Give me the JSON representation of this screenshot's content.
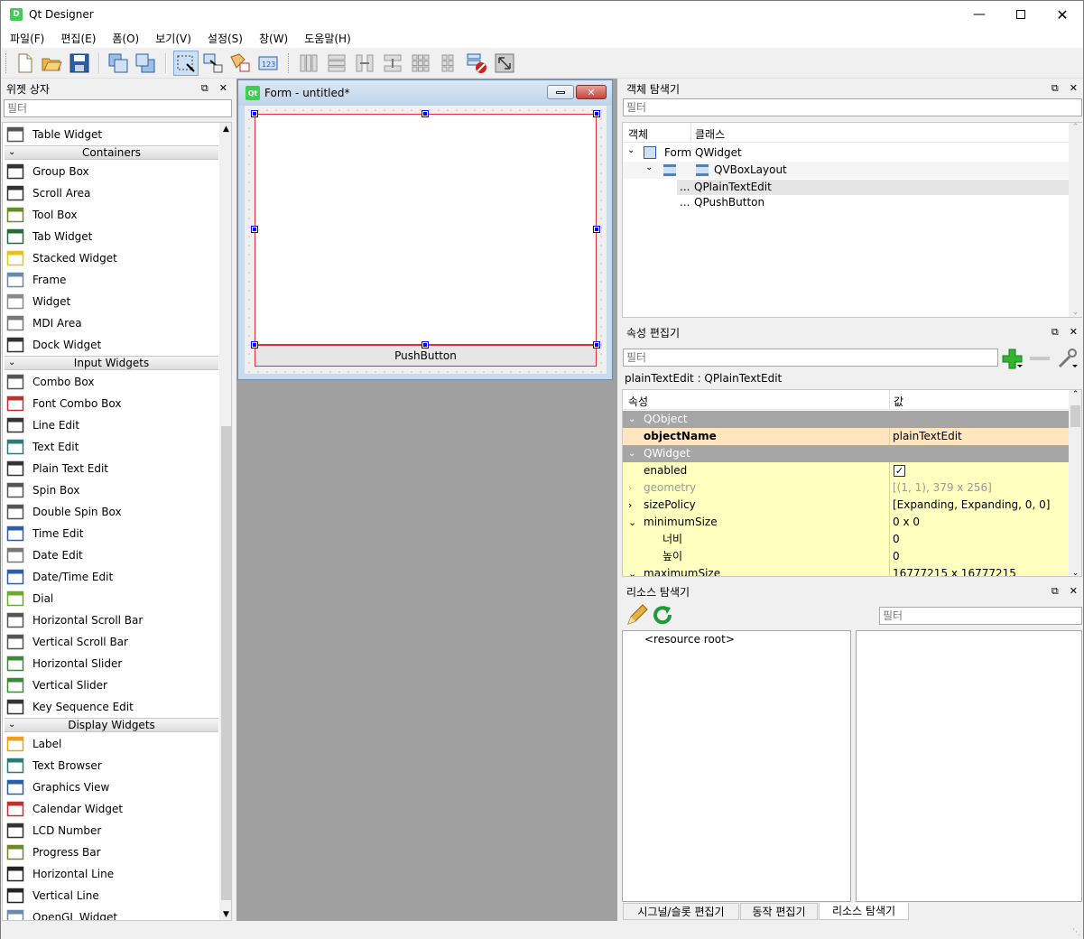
{
  "window": {
    "title": "Qt Designer",
    "app_icon": "D"
  },
  "menu": [
    "파일(F)",
    "편집(E)",
    "폼(O)",
    "보기(V)",
    "설정(S)",
    "창(W)",
    "도움말(H)"
  ],
  "toolbar_icons": [
    "new-file-icon",
    "open-folder-icon",
    "save-icon",
    "bring-to-front-icon",
    "send-to-back-icon",
    "edit-widgets-icon",
    "edit-signals-slots-icon",
    "edit-buddies-icon",
    "edit-tab-order-icon",
    "layout-horizontal-icon",
    "layout-vertical-icon",
    "layout-horizontal-splitter-icon",
    "layout-vertical-splitter-icon",
    "layout-grid-icon",
    "layout-form-icon",
    "break-layout-icon",
    "adjust-size-icon"
  ],
  "widget_box": {
    "title": "위젯 상자",
    "filter_placeholder": "필터",
    "items": [
      {
        "kind": "item",
        "label": "Table Widget",
        "icon": "table-widget-icon"
      },
      {
        "kind": "cat",
        "label": "Containers"
      },
      {
        "kind": "item",
        "label": "Group Box",
        "icon": "group-box-icon"
      },
      {
        "kind": "item",
        "label": "Scroll Area",
        "icon": "scroll-area-icon"
      },
      {
        "kind": "item",
        "label": "Tool Box",
        "icon": "tool-box-icon"
      },
      {
        "kind": "item",
        "label": "Tab Widget",
        "icon": "tab-widget-icon"
      },
      {
        "kind": "item",
        "label": "Stacked Widget",
        "icon": "stacked-widget-icon"
      },
      {
        "kind": "item",
        "label": "Frame",
        "icon": "frame-icon"
      },
      {
        "kind": "item",
        "label": "Widget",
        "icon": "widget-icon"
      },
      {
        "kind": "item",
        "label": "MDI Area",
        "icon": "mdi-area-icon"
      },
      {
        "kind": "item",
        "label": "Dock Widget",
        "icon": "dock-widget-icon"
      },
      {
        "kind": "cat",
        "label": "Input Widgets"
      },
      {
        "kind": "item",
        "label": "Combo Box",
        "icon": "combo-box-icon"
      },
      {
        "kind": "item",
        "label": "Font Combo Box",
        "icon": "font-combo-box-icon"
      },
      {
        "kind": "item",
        "label": "Line Edit",
        "icon": "line-edit-icon"
      },
      {
        "kind": "item",
        "label": "Text Edit",
        "icon": "text-edit-icon"
      },
      {
        "kind": "item",
        "label": "Plain Text Edit",
        "icon": "plain-text-edit-icon"
      },
      {
        "kind": "item",
        "label": "Spin Box",
        "icon": "spin-box-icon"
      },
      {
        "kind": "item",
        "label": "Double Spin Box",
        "icon": "double-spin-box-icon"
      },
      {
        "kind": "item",
        "label": "Time Edit",
        "icon": "time-edit-icon"
      },
      {
        "kind": "item",
        "label": "Date Edit",
        "icon": "date-edit-icon"
      },
      {
        "kind": "item",
        "label": "Date/Time Edit",
        "icon": "date-time-edit-icon"
      },
      {
        "kind": "item",
        "label": "Dial",
        "icon": "dial-icon"
      },
      {
        "kind": "item",
        "label": "Horizontal Scroll Bar",
        "icon": "horizontal-scroll-bar-icon"
      },
      {
        "kind": "item",
        "label": "Vertical Scroll Bar",
        "icon": "vertical-scroll-bar-icon"
      },
      {
        "kind": "item",
        "label": "Horizontal Slider",
        "icon": "horizontal-slider-icon"
      },
      {
        "kind": "item",
        "label": "Vertical Slider",
        "icon": "vertical-slider-icon"
      },
      {
        "kind": "item",
        "label": "Key Sequence Edit",
        "icon": "key-sequence-edit-icon"
      },
      {
        "kind": "cat",
        "label": "Display Widgets"
      },
      {
        "kind": "item",
        "label": "Label",
        "icon": "label-icon"
      },
      {
        "kind": "item",
        "label": "Text Browser",
        "icon": "text-browser-icon"
      },
      {
        "kind": "item",
        "label": "Graphics View",
        "icon": "graphics-view-icon"
      },
      {
        "kind": "item",
        "label": "Calendar Widget",
        "icon": "calendar-widget-icon"
      },
      {
        "kind": "item",
        "label": "LCD Number",
        "icon": "lcd-number-icon"
      },
      {
        "kind": "item",
        "label": "Progress Bar",
        "icon": "progress-bar-icon"
      },
      {
        "kind": "item",
        "label": "Horizontal Line",
        "icon": "horizontal-line-icon"
      },
      {
        "kind": "item",
        "label": "Vertical Line",
        "icon": "vertical-line-icon"
      },
      {
        "kind": "item",
        "label": "OpenGL Widget",
        "icon": "opengl-widget-icon"
      }
    ]
  },
  "form": {
    "title": "Form - untitled*",
    "push_button": "PushButton"
  },
  "object_inspector": {
    "title": "객체 탐색기",
    "filter_placeholder": "필터",
    "col_object": "객체",
    "col_class": "클래스",
    "rows": [
      {
        "object": "Form",
        "class": "QWidget"
      },
      {
        "object": "",
        "class": "QVBoxLayout"
      },
      {
        "object": "...",
        "class": "QPlainTextEdit"
      },
      {
        "object": "...",
        "class": "QPushButton"
      }
    ]
  },
  "property_editor": {
    "title": "속성 편집기",
    "filter_placeholder": "필터",
    "object_label": "plainTextEdit : QPlainTextEdit",
    "col_property": "속성",
    "col_value": "값",
    "rows": [
      {
        "type": "group",
        "name": "QObject"
      },
      {
        "type": "prop",
        "name": "objectName",
        "value": "plainTextEdit",
        "style": "bold-peach"
      },
      {
        "type": "group",
        "name": "QWidget"
      },
      {
        "type": "prop",
        "name": "enabled",
        "value": "",
        "check": true,
        "style": "yellow"
      },
      {
        "type": "prop",
        "name": "geometry",
        "value": "[(1, 1), 379 x 256]",
        "style": "disabled",
        "expander": "›"
      },
      {
        "type": "prop",
        "name": "sizePolicy",
        "value": "[Expanding, Expanding, 0, 0]",
        "style": "yellow",
        "expander": "›"
      },
      {
        "type": "prop",
        "name": "minimumSize",
        "value": "0 x 0",
        "style": "yellow",
        "expander": "⌄"
      },
      {
        "type": "sub",
        "name": "너비",
        "value": "0",
        "style": "yellow"
      },
      {
        "type": "sub",
        "name": "높이",
        "value": "0",
        "style": "yellow"
      },
      {
        "type": "prop",
        "name": "maximumSize",
        "value": "16777215 x 16777215",
        "style": "yellow",
        "expander": "⌄"
      }
    ]
  },
  "resource_browser": {
    "title": "리소스 탐색기",
    "filter_placeholder": "필터",
    "root": "<resource root>"
  },
  "bottom_tabs": [
    "시그널/슬롯 편집기",
    "동작 편집기",
    "리소스 탐색기"
  ],
  "colors": {
    "accent_green": "#41cd52",
    "selection": "#e5e5e5",
    "group_header": "#a6a6a6",
    "prop_yellow": "#ffffbf",
    "prop_peach": "#ffe6bf"
  }
}
